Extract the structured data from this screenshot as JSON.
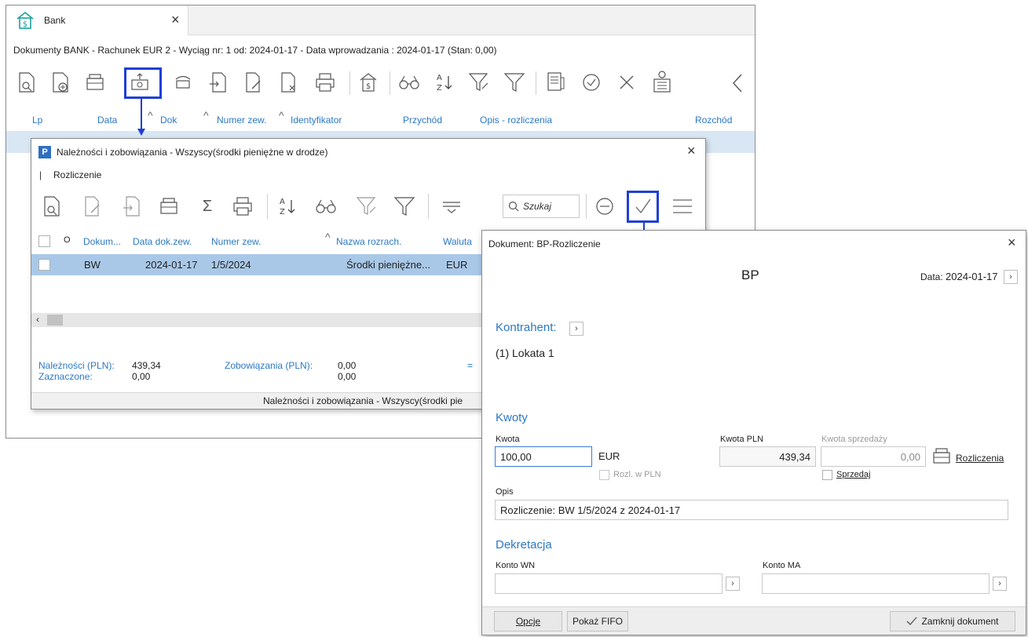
{
  "bank": {
    "tab_title": "Bank",
    "doc_title": "Dokumenty BANK - Rachunek EUR 2 - Wyciąg nr: 1 od: 2024-01-17 - Data wprowadzania : 2024-01-17   (Stan: 0,00)",
    "columns": {
      "lp": "Lp",
      "data": "Data",
      "dok": "Dok",
      "numer_zew": "Numer zew.",
      "identyfikator": "Identyfikator",
      "przychod": "Przychód",
      "opis": "Opis - rozliczenia",
      "rozchod": "Rozchód"
    }
  },
  "naleznosci": {
    "title": "Należności i zobowiązania - Wszyscy(środki pieniężne w drodze)",
    "menu_item": "Rozliczenie",
    "search_placeholder": "Szukaj",
    "columns": {
      "dokum": "Dokum...",
      "data_dok": "Data dok.zew.",
      "numer_zew": "Numer zew.",
      "nazwa": "Nazwa rozrach.",
      "waluta": "Waluta"
    },
    "row": {
      "dokum": "BW",
      "data_dok": "2024-01-17",
      "numer_zew": "1/5/2024",
      "nazwa": "Środki pieniężne...",
      "waluta": "EUR"
    },
    "footer": {
      "naleznosci_label": "Należności (PLN):",
      "naleznosci_value": "439,34",
      "zobowiazania_label": "Zobowiązania (PLN):",
      "zobowiazania_value": "0,00",
      "equals": "=",
      "zaznaczone_label": "Zaznaczone:",
      "zaznaczone_value": "0,00",
      "zaznaczone_value2": "0,00"
    },
    "status_bar": "Należności i zobowiązania - Wszyscy(środki pie"
  },
  "dokument": {
    "title": "Dokument: BP-Rozliczenie",
    "doc_code": "BP",
    "data_label": "Data:",
    "data_value": "2024-01-17",
    "kontrahent_header": "Kontrahent:",
    "kontrahent_value": "(1) Lokata 1",
    "kwoty_header": "Kwoty",
    "kwota_label": "Kwota",
    "kwota_value": "100,00",
    "currency": "EUR",
    "rozl_w_pln": "Rozl. w PLN",
    "kwota_pln_label": "Kwota PLN",
    "kwota_pln_value": "439,34",
    "kwota_sprzedazy_label": "Kwota sprzedaży",
    "kwota_sprzedazy_value": "0,00",
    "sprzedaj": "Sprzedaj",
    "rozliczenia_button": "Rozliczenia",
    "opis_label": "Opis",
    "opis_value": "Rozliczenie: BW 1/5/2024 z 2024-01-17",
    "dekretacja_header": "Dekretacja",
    "konto_wn_label": "Konto WN",
    "konto_ma_label": "Konto MA",
    "opcje_button": "Opcje",
    "pokaz_fifo_button": "Pokaż FIFO",
    "zamknij_button": "Zamknij dokument"
  },
  "colors": {
    "accent_blue": "#2c78c4",
    "highlight_border": "#1f3fd6",
    "selected_row": "#a9c8e8",
    "row_band": "#d9e6f3"
  }
}
